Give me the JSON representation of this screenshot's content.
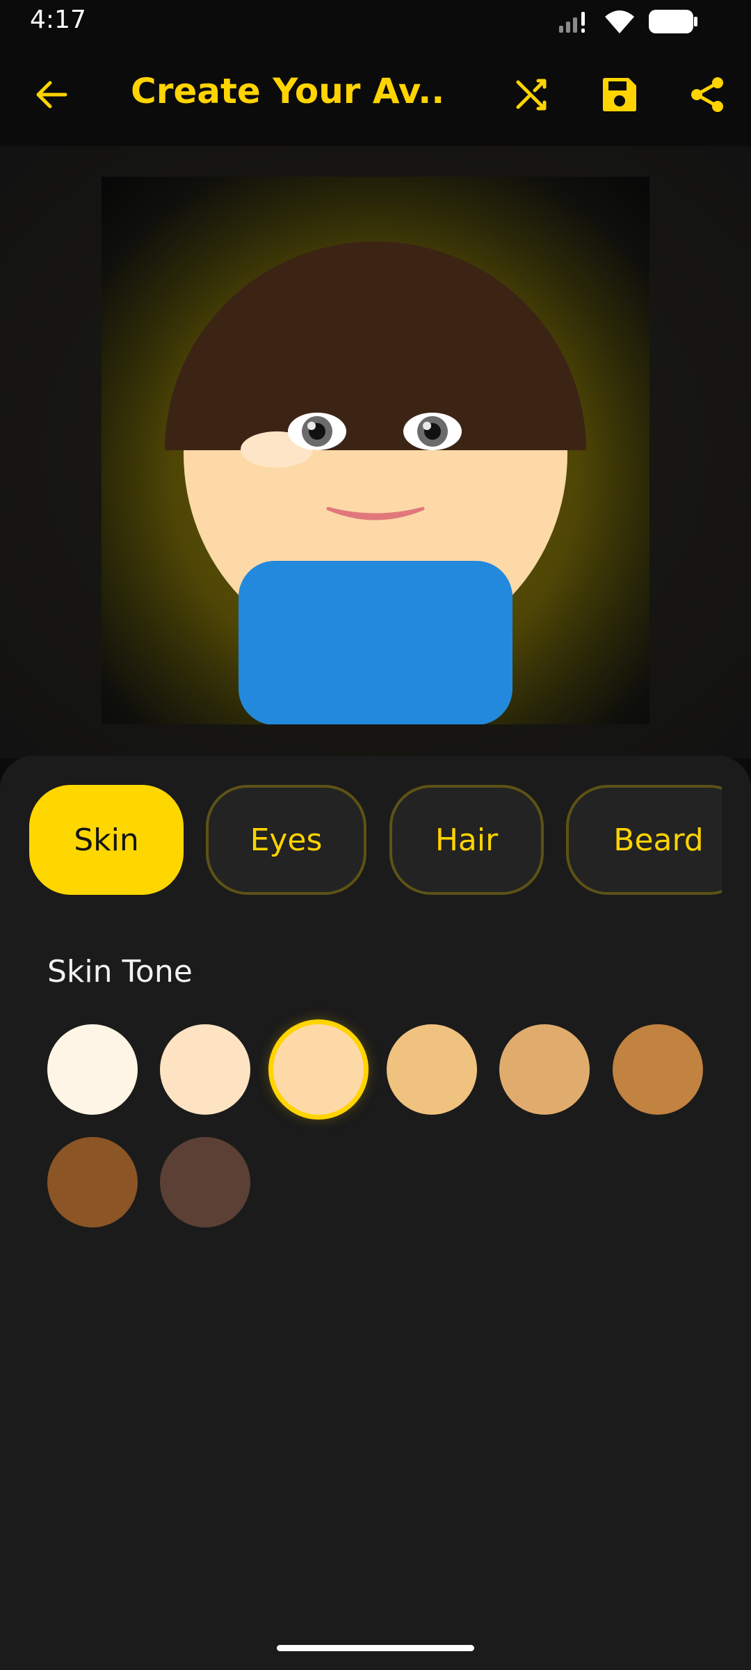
{
  "status_bar": {
    "time": "4:17"
  },
  "app_bar": {
    "title": "Create Your Av...",
    "back_icon": "arrow-left-icon",
    "actions": [
      "shuffle-icon",
      "save-icon",
      "share-icon"
    ]
  },
  "colors": {
    "accent": "#ffd400",
    "background": "#0b0b0b",
    "panel": "#1b1b1b",
    "hair": "#3c2415",
    "skin": "#fdd9a8",
    "shirt": "#2389dc",
    "mouth": "#e0787b"
  },
  "tabs": [
    {
      "label": "Skin",
      "active": true
    },
    {
      "label": "Eyes",
      "active": false
    },
    {
      "label": "Hair",
      "active": false
    },
    {
      "label": "Beard",
      "active": false
    }
  ],
  "section": {
    "title": "Skin Tone"
  },
  "skin_tones": [
    {
      "color": "#fff5e6",
      "selected": false
    },
    {
      "color": "#fde3c2",
      "selected": false
    },
    {
      "color": "#fdd9a8",
      "selected": true
    },
    {
      "color": "#f0c27f",
      "selected": false
    },
    {
      "color": "#e0ac6d",
      "selected": false
    },
    {
      "color": "#c28240",
      "selected": false
    },
    {
      "color": "#8b5526",
      "selected": false
    },
    {
      "color": "#5c4035",
      "selected": false
    }
  ]
}
